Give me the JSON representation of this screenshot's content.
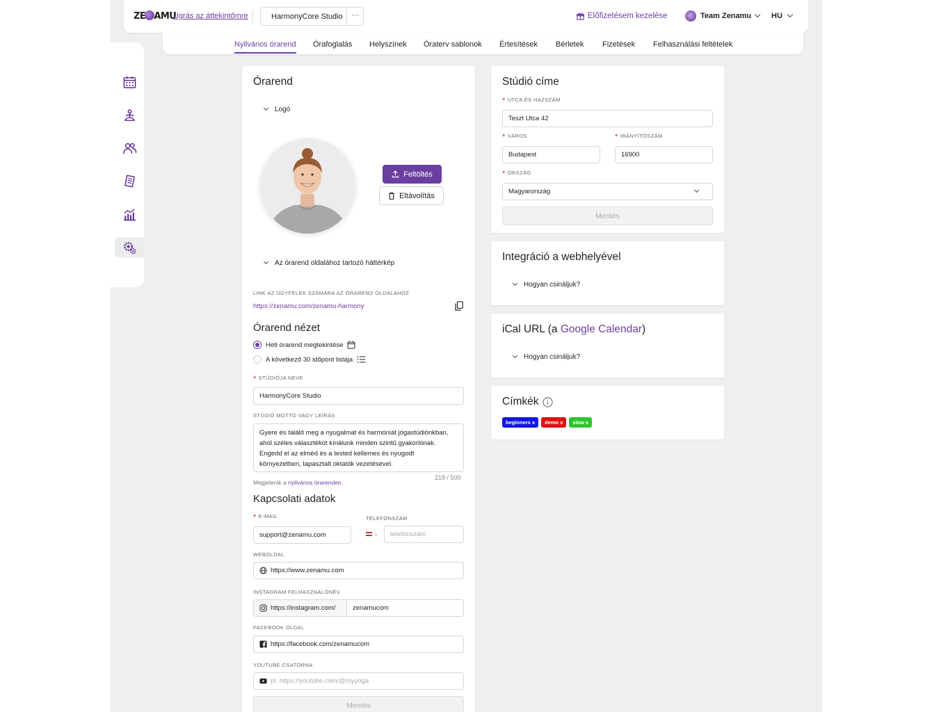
{
  "colors": {
    "accent": "#6a3fa0",
    "tag_beginners": "#1414e6",
    "tag_demo": "#e01010",
    "tag_slow": "#2fc42f"
  },
  "header": {
    "logo": "ZENAMU",
    "jump_link": "Ugrás az áttekintőmre",
    "studio_name": "HarmonyCore Studio",
    "more": "···",
    "subscription": "Előfizetésem kezelése",
    "team": "Team Zenamu",
    "lang": "HU"
  },
  "tabs": [
    "Nyilvános órarend",
    "Órafoglalás",
    "Helyszínek",
    "Óraterv sablonok",
    "Értesítések",
    "Bérletek",
    "Fizetések",
    "Felhasználási feltételek"
  ],
  "sidebar": [
    "calendar-icon",
    "yoga-icon",
    "users-icon",
    "document-icon",
    "stats-icon",
    "settings-icon"
  ],
  "schedule": {
    "title": "Órarend",
    "logo_section": "Logó",
    "upload": "Feltöltés",
    "remove": "Eltávolítás",
    "background_section": "Az órarend oldalához tartozó háttérkép",
    "link_label": "LINK AZ ÜGYFELEK SZÁMÁRA AZ ÓRAREND OLDALÁHOZ",
    "link": "https://zenamu.com/zenamu-harmony",
    "view_title": "Órarend nézet",
    "view_weekly": "Heti órarend megtekintése",
    "view_list": "A következő 30 időpont listája",
    "studio_name_label": "STÚDIÓJA NEVE",
    "studio_name": "HarmonyCore Studio",
    "motto_label": "STÚDIÓ MOTTÓ VAGY LEÍRÁS",
    "motto": "Gyere és találd meg a nyugalmat és harmóniát jógastúdiónkban,\nahol széles választékot kínálunk minden szintű gyakorlónak.\nEngedd el az elméd és a tested kellemes és nyugodt\nkörnyezetben, tapasztalt oktatók vezetésével.",
    "counter": "218 / 500",
    "hint_prefix": "Megjelenik a ",
    "hint_link": "nyilvános órarenden",
    "hint_suffix": ".",
    "contact_title": "Kapcsolati adatok",
    "email_label": "E-MAIL",
    "email": "support@zenamu.com",
    "phone_label": "TELEFONSZÁM",
    "phone_placeholder": "telefonszám",
    "website_label": "WEBOLDAL",
    "website": "https://www.zenamu.com",
    "instagram_label": "INSTAGRAM FELHASZNÁLÓNÉV",
    "instagram_prefix": "https://instagram.com/",
    "instagram": "zenamucom",
    "facebook_label": "FACEBOOK OLDAL",
    "facebook": "https://facebook.com/zenamucom",
    "youtube_label": "YOUTUBE CSATORNA",
    "youtube_placeholder": "pl. https://youtube.com/@myyoga",
    "save": "Mentés"
  },
  "address": {
    "title": "Stúdió címe",
    "street_label": "UTCA ÉS HÁZSZÁM",
    "street": "Teszt Utca 42",
    "city_label": "VÁROS",
    "city": "Budapest",
    "zip_label": "IRÁNYÍTÓSZÁM",
    "zip": "16900",
    "country_label": "ORSZÁG",
    "country": "Magyarország",
    "save": "Mentés"
  },
  "integration": {
    "title": "Integráció a webhelyével",
    "howto": "Hogyan csináljuk?"
  },
  "ical": {
    "title_prefix": "iCal URL (a ",
    "title_link": "Google Calendar",
    "title_suffix": ")",
    "howto": "Hogyan csináljuk?"
  },
  "labels": {
    "title": "Címkék",
    "tags": [
      {
        "name": "beginners"
      },
      {
        "name": "demo"
      },
      {
        "name": "slow"
      }
    ],
    "remove": "x"
  }
}
